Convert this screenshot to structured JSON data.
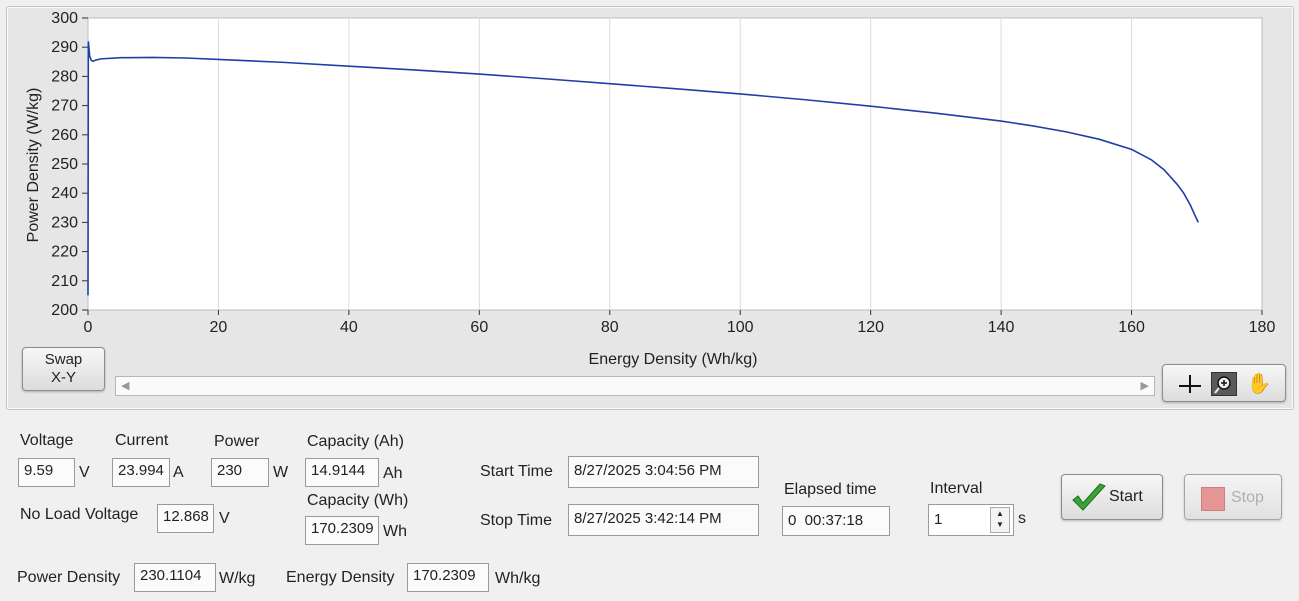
{
  "graph": {
    "swap_label_line1": "Swap",
    "swap_label_line2": "X-Y"
  },
  "chart_data": {
    "type": "line",
    "xlabel": "Energy Density (Wh/kg)",
    "ylabel": "Power Density (W/kg)",
    "xlim": [
      0,
      180
    ],
    "ylim": [
      200,
      300
    ],
    "xticks": [
      "0",
      "20",
      "40",
      "60",
      "80",
      "100",
      "120",
      "140",
      "160",
      "180"
    ],
    "yticks": [
      "200",
      "210",
      "220",
      "230",
      "240",
      "250",
      "260",
      "270",
      "280",
      "290",
      "300"
    ],
    "grid": true,
    "line_color": "#1f3fa6",
    "series": [
      {
        "x": [
          0,
          0.05,
          0.1,
          0.25,
          0.5,
          0.8,
          1.2,
          2,
          5,
          10,
          15,
          20,
          30,
          40,
          50,
          60,
          70,
          80,
          90,
          100,
          110,
          120,
          130,
          140,
          145,
          150,
          155,
          160,
          163,
          165,
          167,
          168,
          169,
          169.6,
          170.2309
        ],
        "y": [
          205,
          292,
          291,
          287,
          285.5,
          285.2,
          285.6,
          286,
          286.4,
          286.5,
          286.3,
          285.8,
          284.8,
          283.5,
          282.2,
          280.8,
          279.2,
          277.5,
          275.8,
          274,
          272,
          269.8,
          267.4,
          264.7,
          263,
          261,
          258.5,
          255,
          251.5,
          248,
          243,
          240,
          236,
          233,
          230
        ]
      }
    ]
  },
  "readouts": {
    "voltage": {
      "label": "Voltage",
      "value": "9.59",
      "unit": "V"
    },
    "current": {
      "label": "Current",
      "value": "23.994",
      "unit": "A"
    },
    "power": {
      "label": "Power",
      "value": "230",
      "unit": "W"
    },
    "capacity_ah": {
      "label": "Capacity (Ah)",
      "value": "14.9144",
      "unit": "Ah"
    },
    "capacity_wh": {
      "label": "Capacity (Wh)",
      "value": "170.2309",
      "unit": "Wh"
    },
    "no_load_voltage": {
      "label": "No Load Voltage",
      "value": "12.868",
      "unit": "V"
    },
    "power_density": {
      "label": "Power Density",
      "value": "230.1104",
      "unit": "W/kg"
    },
    "energy_density": {
      "label": "Energy Density",
      "value": "170.2309",
      "unit": "Wh/kg"
    },
    "start_time": {
      "label": "Start Time",
      "value": "8/27/2025 3:04:56 PM"
    },
    "stop_time": {
      "label": "Stop Time",
      "value": "8/27/2025 3:42:14 PM"
    },
    "elapsed_time": {
      "label": "Elapsed time",
      "value": "0  00:37:18"
    },
    "interval": {
      "label": "Interval",
      "value": "1",
      "unit": "s"
    }
  },
  "buttons": {
    "start": "Start",
    "stop": "Stop"
  },
  "colors": {
    "plot_bg": "#ffffff",
    "trace": "#1f3fa6",
    "stop_square": "#e07878",
    "check": "#3aa335"
  }
}
